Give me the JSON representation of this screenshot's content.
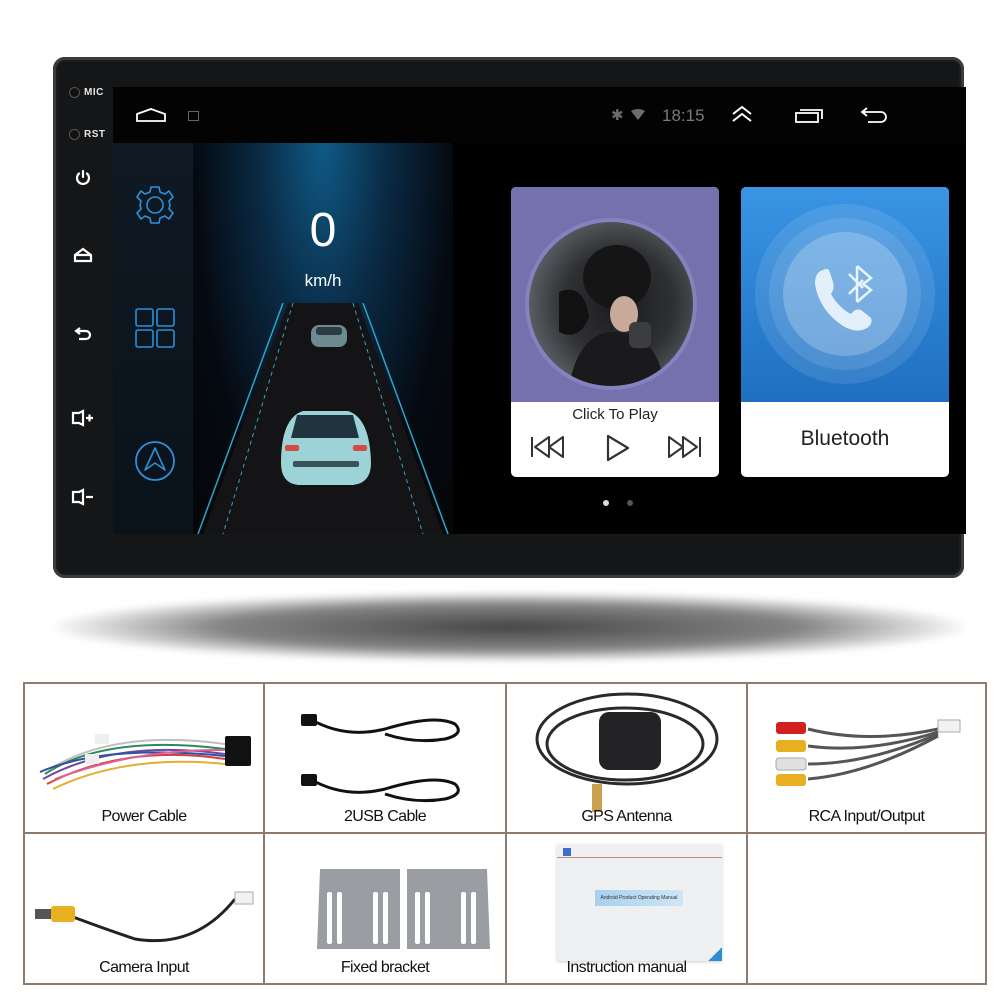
{
  "device": {
    "side_labels": {
      "mic": "MIC",
      "rst": "RST"
    },
    "hardware_buttons": [
      {
        "name": "power",
        "icon": "power-icon"
      },
      {
        "name": "home",
        "icon": "home-icon"
      },
      {
        "name": "back",
        "icon": "back-icon"
      },
      {
        "name": "volume-up",
        "icon": "volume-up-icon"
      },
      {
        "name": "volume-down",
        "icon": "volume-down-icon"
      }
    ]
  },
  "statusbar": {
    "time": "18:15",
    "bluetooth_glyph": "✱",
    "icons": [
      "home-icon",
      "screenshot-icon",
      "bluetooth-icon",
      "wifi-icon",
      "expand-up-icon",
      "recent-apps-icon",
      "back-icon"
    ]
  },
  "dock": {
    "items": [
      {
        "name": "settings",
        "icon": "gear-icon"
      },
      {
        "name": "apps",
        "icon": "apps-grid-icon"
      },
      {
        "name": "navigation",
        "icon": "navigation-icon"
      }
    ]
  },
  "speedometer": {
    "value": "0",
    "unit": "km/h"
  },
  "music_card": {
    "title": "Click To Play",
    "controls": [
      "previous-icon",
      "play-icon",
      "next-icon"
    ]
  },
  "bluetooth_card": {
    "label": "Bluetooth"
  },
  "pager": {
    "pages": 2,
    "active": 1
  },
  "accessories": [
    {
      "label": "Power Cable"
    },
    {
      "label": "2USB  Cable"
    },
    {
      "label": "GPS  Antenna"
    },
    {
      "label": "RCA Input/Output"
    },
    {
      "label": "Camera  Input"
    },
    {
      "label": "Fixed bracket"
    },
    {
      "label": "Instruction manual"
    },
    {
      "label": ""
    }
  ],
  "manual_cover": {
    "title": "Android Product Operating Manual"
  },
  "colors": {
    "accent_blue": "#2f8fe0",
    "music_purple": "#7372ad",
    "dock_icon": "#2e8fd6",
    "grid_border": "#8f7a70"
  }
}
